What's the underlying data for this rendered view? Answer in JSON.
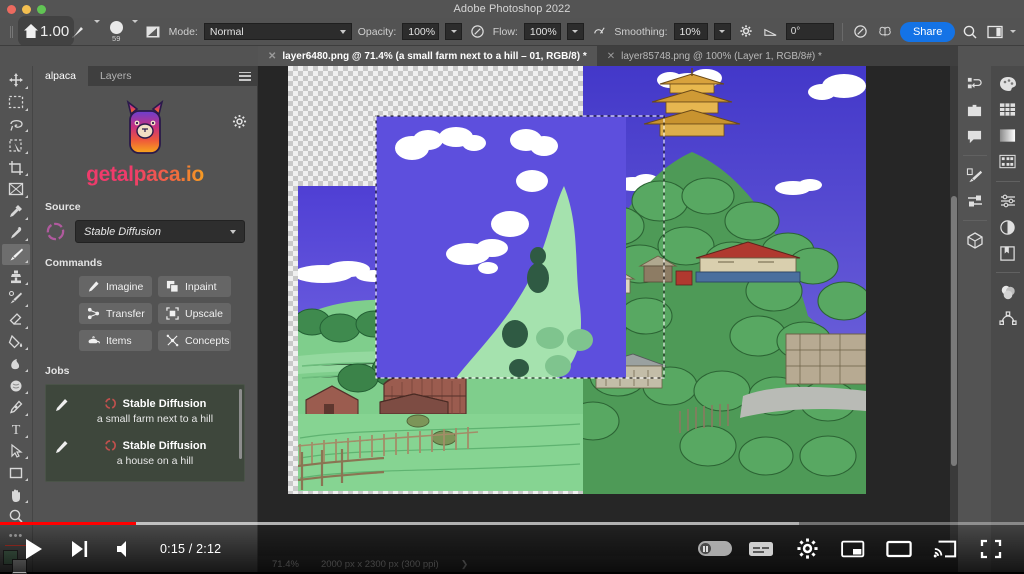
{
  "window": {
    "title": "Adobe Photoshop 2022",
    "traffic_lights": [
      "close",
      "minimize",
      "maximize"
    ]
  },
  "overlay_badge": {
    "icon": "home-icon",
    "value": "1.00"
  },
  "options_bar": {
    "brush_preset_icon": "brush-preset-icon",
    "brush_size": "59",
    "brush_settings_icon": "brush-settings-icon",
    "mode_label": "Mode:",
    "mode_value": "Normal",
    "opacity_label": "Opacity:",
    "opacity_value": "100%",
    "opacity_pressure_icon": "pressure-opacity-icon",
    "flow_label": "Flow:",
    "flow_value": "100%",
    "airbrush_icon": "airbrush-icon",
    "smoothing_label": "Smoothing:",
    "smoothing_value": "10%",
    "smoothing_options_icon": "smoothing-options-gear-icon",
    "angle_icon": "brush-angle-icon",
    "angle_value": "0°",
    "pressure_size_icon": "pressure-size-icon",
    "symmetry_icon": "symmetry-butterfly-icon",
    "share_label": "Share",
    "search_icon": "search-icon",
    "workspace_icon": "workspace-layout-icon"
  },
  "tabs": [
    {
      "label": "layer6480.png @ 71.4% (a small farm next to a hill – 01, RGB/8) *",
      "active": true,
      "close_icon": "close-icon"
    },
    {
      "label": "layer85748.png @ 100% (Layer 1, RGB/8#) *",
      "active": false,
      "close_icon": "close-icon"
    }
  ],
  "toolbar": {
    "tools": [
      {
        "name": "move-tool",
        "icon": "move-icon",
        "active": false
      },
      {
        "name": "rectangular-marquee-tool",
        "icon": "marquee-icon",
        "active": false
      },
      {
        "name": "lasso-tool",
        "icon": "lasso-icon",
        "active": false
      },
      {
        "name": "object-selection-tool",
        "icon": "quick-selection-icon",
        "active": false
      },
      {
        "name": "crop-tool",
        "icon": "crop-icon",
        "active": false
      },
      {
        "name": "frame-tool",
        "icon": "frame-icon",
        "active": false
      },
      {
        "name": "eyedropper-tool",
        "icon": "eyedropper-icon",
        "active": false
      },
      {
        "name": "spot-healing-brush-tool",
        "icon": "healing-brush-icon",
        "active": false
      },
      {
        "name": "brush-tool",
        "icon": "brush-icon",
        "active": true
      },
      {
        "name": "clone-stamp-tool",
        "icon": "clone-stamp-icon",
        "active": false
      },
      {
        "name": "history-brush-tool",
        "icon": "history-brush-icon",
        "active": false
      },
      {
        "name": "eraser-tool",
        "icon": "eraser-icon",
        "active": false
      },
      {
        "name": "gradient-tool",
        "icon": "paint-bucket-icon",
        "active": false
      },
      {
        "name": "blur-tool",
        "icon": "blur-drop-icon",
        "active": false
      },
      {
        "name": "dodge-tool",
        "icon": "dodge-icon",
        "active": false
      },
      {
        "name": "pen-tool",
        "icon": "pen-icon",
        "active": false
      },
      {
        "name": "type-tool",
        "icon": "type-t-icon",
        "active": false
      },
      {
        "name": "path-selection-tool",
        "icon": "path-arrow-icon",
        "active": false
      },
      {
        "name": "rectangle-tool",
        "icon": "rectangle-icon",
        "active": false
      },
      {
        "name": "hand-tool",
        "icon": "hand-icon",
        "active": false
      },
      {
        "name": "zoom-tool",
        "icon": "magnifier-icon",
        "active": false
      }
    ],
    "more_tools": "•••",
    "foreground_color": "#51735b",
    "background_color": "#a9a9a9"
  },
  "alpaca_panel": {
    "tabs": [
      {
        "label": "alpaca",
        "active": true
      },
      {
        "label": "Layers",
        "active": false
      }
    ],
    "menu_icon": "panel-menu-icon",
    "gear_icon": "gear-icon",
    "logo_icon": "alpaca-llama-logo",
    "brand": "getalpaca.io",
    "source": {
      "label": "Source",
      "status_icon": "loading-ring-icon",
      "selected": "Stable Diffusion",
      "chevron_icon": "chevron-down-icon"
    },
    "commands": {
      "label": "Commands",
      "buttons": [
        {
          "label": "Imagine",
          "icon": "pencil-icon"
        },
        {
          "label": "Inpaint",
          "icon": "layers-copy-icon"
        },
        {
          "label": "Transfer",
          "icon": "transfer-nodes-icon"
        },
        {
          "label": "Upscale",
          "icon": "upscale-frame-icon"
        },
        {
          "label": "Items",
          "icon": "teapot-icon"
        },
        {
          "label": "Concepts",
          "icon": "concepts-star-icon"
        }
      ]
    },
    "jobs": {
      "label": "Jobs",
      "items": [
        {
          "edit_icon": "pencil-icon",
          "status_icon": "loading-ring-icon",
          "title": "Stable Diffusion",
          "prompt": "a small farm next to a hill"
        },
        {
          "edit_icon": "pencil-icon",
          "status_icon": "loading-ring-icon",
          "title": "Stable Diffusion",
          "prompt": "a house on a hill"
        }
      ]
    }
  },
  "canvas": {
    "description": "anime landscape artwork: blue-purple sky with white clouds, green hills, red barn farmhouse with wooden fences on the left, forested hill with Japanese pagoda temple and traditional buildings on the right; transparency checkerboard visible around edges; dashed selection marquee over the center",
    "selection_marquee": "active",
    "colors": {
      "sky": "#5b4fd6",
      "grass": "#8fd69b",
      "dark_grass": "#6aab78",
      "barn_red": "#9e5c4e",
      "checker": "#c9c9c9"
    }
  },
  "status_bar": {
    "zoom": "71.4%",
    "dimensions": "2000 px x 2300 px (300 ppi)",
    "expand_icon": "chevron-right-icon"
  },
  "right_rails": {
    "column_one": [
      {
        "name": "history-panel",
        "icon": "history-icon"
      },
      {
        "name": "actions-panel",
        "icon": "actions-icon"
      },
      {
        "name": "comments-panel",
        "icon": "comment-icon"
      },
      {
        "name": "brush-settings-panel",
        "icon": "brush-settings-panel-icon"
      },
      {
        "name": "adjustments-panel",
        "icon": "sliders-icon"
      },
      {
        "name": "3d-panel",
        "icon": "cube-icon"
      }
    ],
    "column_two": [
      {
        "name": "color-panel",
        "icon": "palette-icon"
      },
      {
        "name": "swatches-panel",
        "icon": "swatches-grid-icon"
      },
      {
        "name": "gradients-panel",
        "icon": "gradient-icon"
      },
      {
        "name": "patterns-panel",
        "icon": "patterns-icon"
      },
      {
        "name": "properties-panel",
        "icon": "properties-sliders-icon"
      },
      {
        "name": "adjustment-layers-panel",
        "icon": "half-circle-icon"
      },
      {
        "name": "libraries-panel",
        "icon": "libraries-icon"
      },
      {
        "name": "channels-panel",
        "icon": "channels-icon"
      },
      {
        "name": "paths-panel",
        "icon": "paths-icon"
      }
    ]
  },
  "video_player": {
    "current_time": "0:15",
    "duration": "2:12",
    "time_display": "0:15 / 2:12",
    "progress_percent": 13.3,
    "buffered_percent": 78,
    "progress_color": "#ff0000",
    "controls": {
      "play_icon": "play-icon",
      "next_icon": "next-video-icon",
      "volume_icon": "volume-icon",
      "autoplay_toggle": "autoplay-toggle",
      "subtitles_icon": "subtitles-cc-icon",
      "settings_icon": "settings-gear-icon",
      "miniplayer_icon": "miniplayer-icon",
      "theater_icon": "theater-mode-icon",
      "cast_icon": "cast-icon",
      "fullscreen_icon": "fullscreen-icon"
    }
  }
}
